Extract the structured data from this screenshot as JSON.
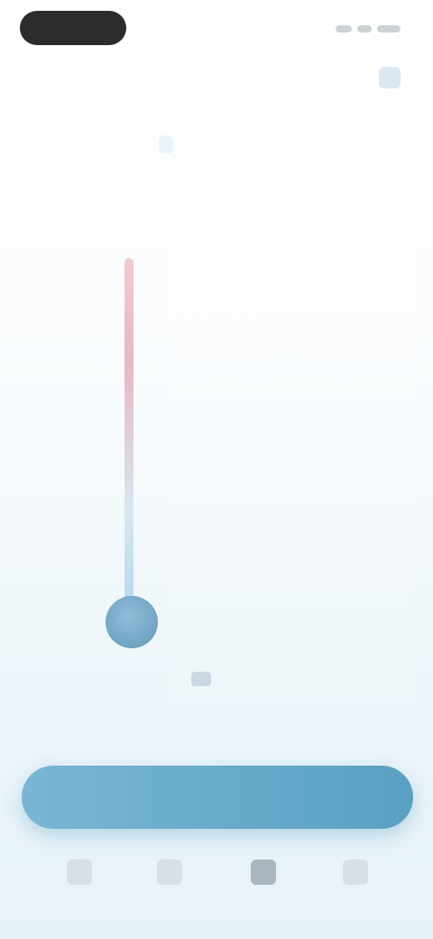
{
  "status_bar": {
    "time": ""
  },
  "header": {
    "title": "",
    "action_icon": "calendar-icon",
    "sub_link": ""
  },
  "thermometer": {
    "scale_ticks": [
      "",
      "",
      "",
      "",
      "",
      "",
      ""
    ],
    "level_fraction": 0.52
  },
  "reading": {
    "label": "",
    "value": "",
    "unit": ""
  },
  "secondary": {
    "label": "",
    "value": "",
    "unit": ""
  },
  "time_value": "",
  "options": [
    "",
    ""
  ],
  "toggle": {
    "label": ""
  },
  "cta": {
    "label": ""
  },
  "tabs": [
    {
      "label": "",
      "icon": "home-icon"
    },
    {
      "label": "",
      "icon": "chart-icon"
    },
    {
      "label": "",
      "icon": "thermometer-icon"
    },
    {
      "label": "",
      "icon": "profile-icon"
    }
  ],
  "colors": {
    "accent": "#5aa0c2",
    "thermo_hot": "#e7b9c3",
    "thermo_cold": "#74a8c6"
  }
}
